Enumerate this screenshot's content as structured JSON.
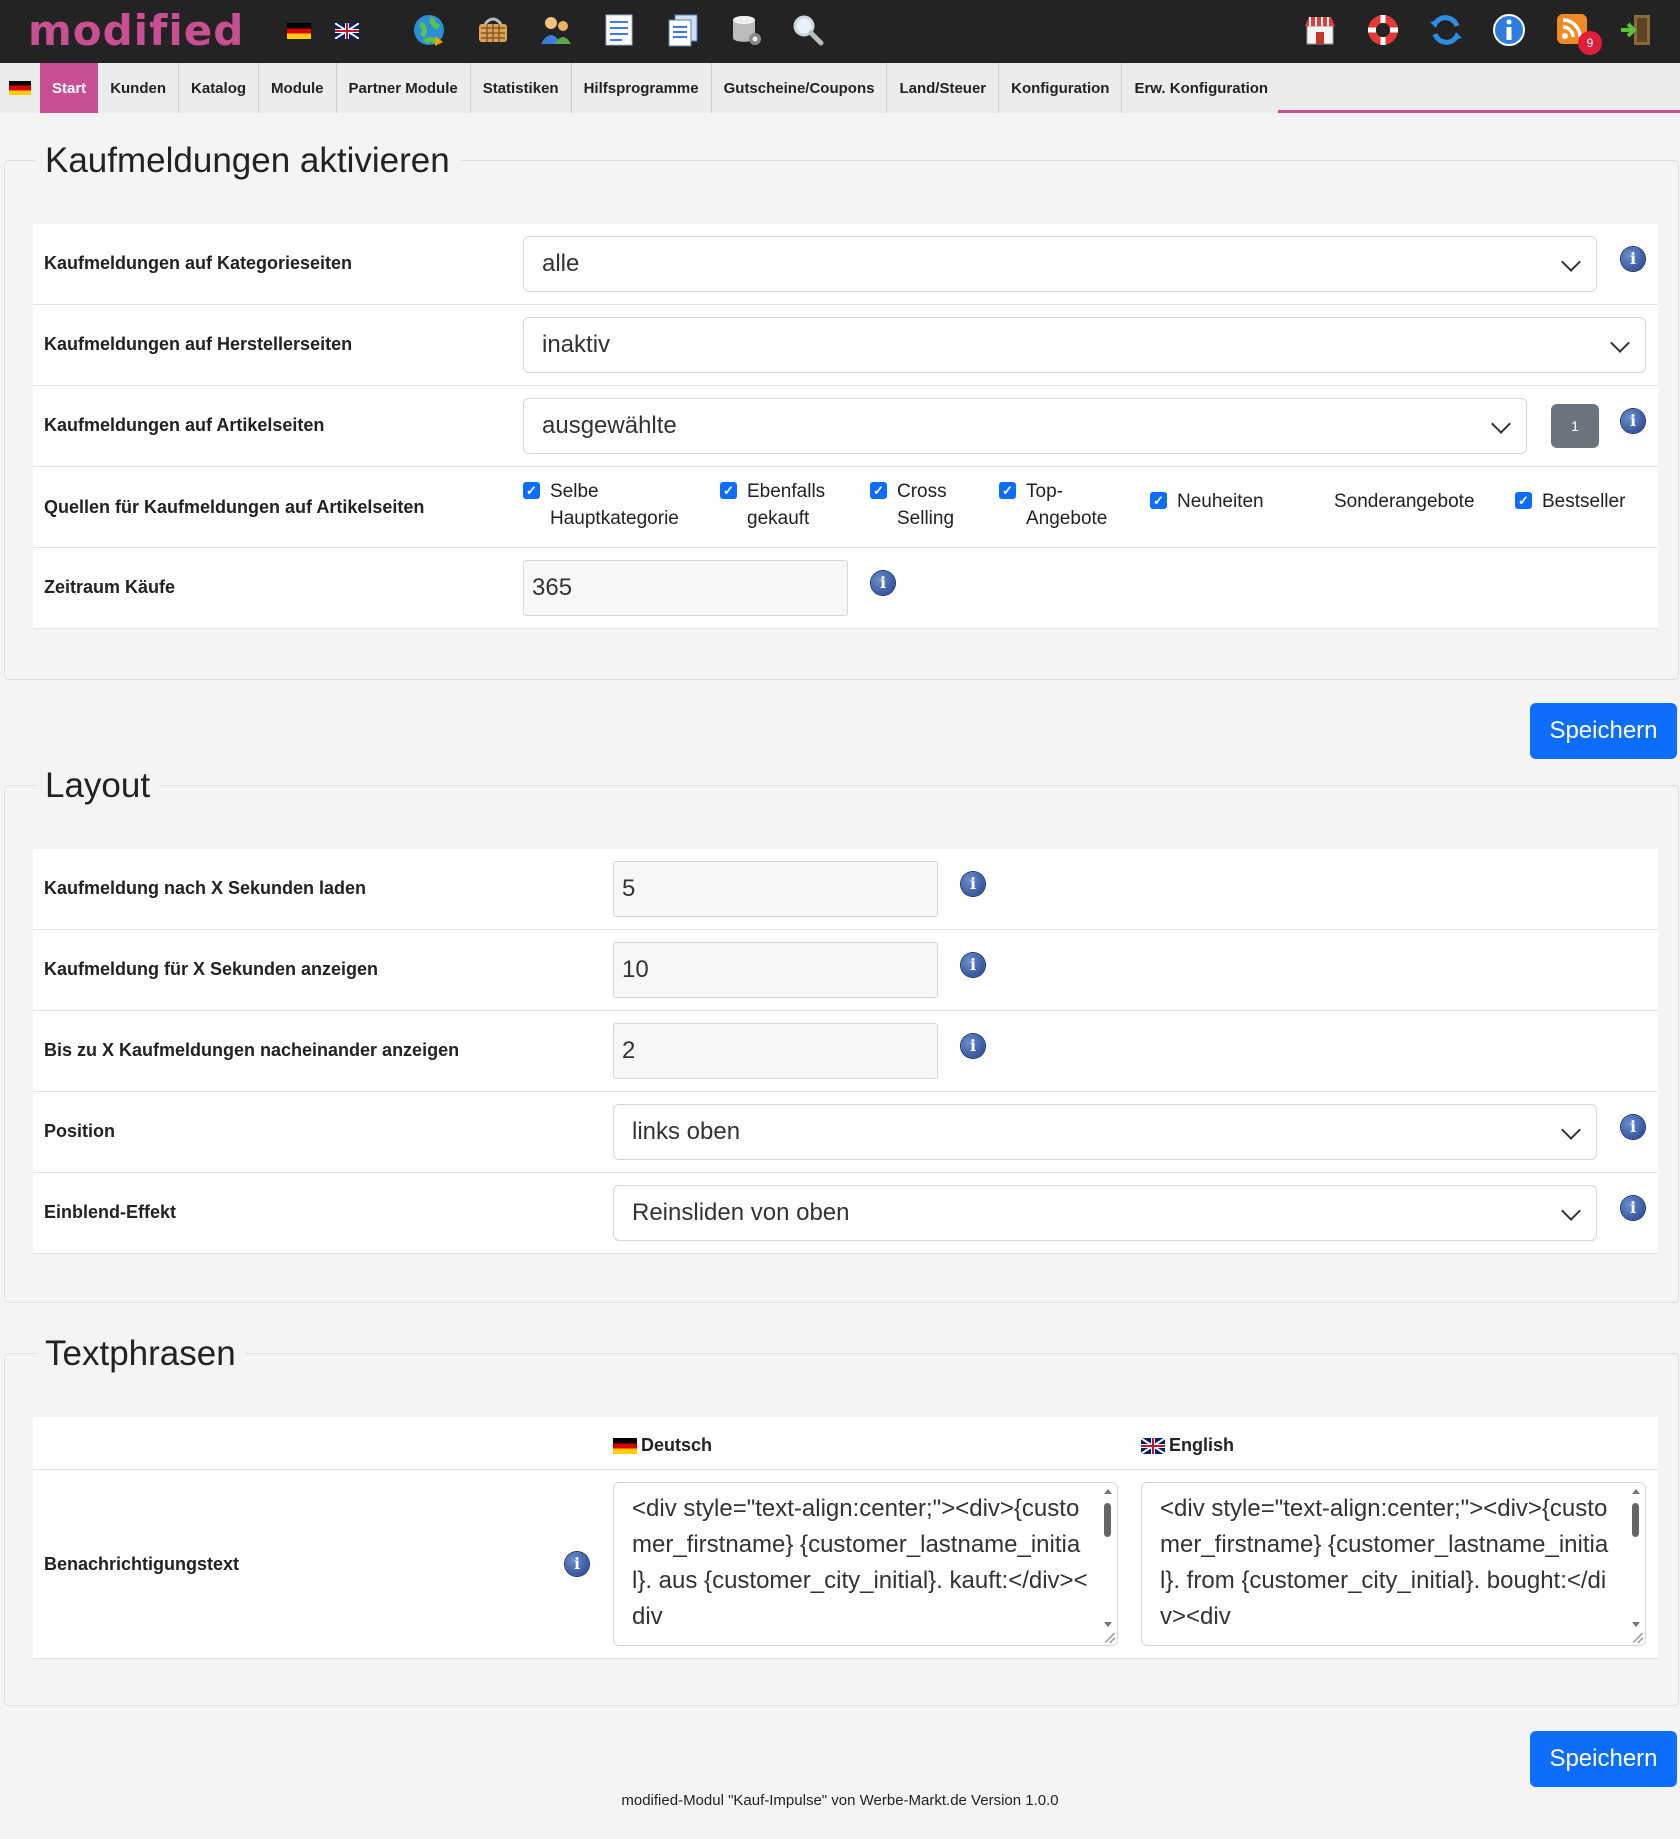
{
  "app": {
    "logo": "modified"
  },
  "topbar": {
    "flags": [
      "de-flag",
      "gb-flag"
    ],
    "left_icons": [
      "globe-icon",
      "basket-icon",
      "customers-icon",
      "orders-icon",
      "documents-icon",
      "database-icon",
      "search-icon"
    ],
    "right_icons": [
      "shop-icon",
      "support-icon",
      "refresh-icon",
      "info-icon",
      "rss-icon",
      "logout-icon"
    ],
    "notification_count": "9",
    "accent": "#c94f93"
  },
  "nav": {
    "items": [
      {
        "label": "Start",
        "active": true
      },
      {
        "label": "Kunden"
      },
      {
        "label": "Katalog"
      },
      {
        "label": "Module"
      },
      {
        "label": "Partner Module"
      },
      {
        "label": "Statistiken"
      },
      {
        "label": "Hilfsprogramme"
      },
      {
        "label": "Gutscheine/Coupons"
      },
      {
        "label": "Land/Steuer"
      },
      {
        "label": "Konfiguration"
      },
      {
        "label": "Erw. Konfiguration"
      }
    ]
  },
  "section1": {
    "title": "Kaufmeldungen aktivieren",
    "rows": {
      "category": {
        "label": "Kaufmeldungen auf Kategorieseiten",
        "value": "alle"
      },
      "manufacturer": {
        "label": "Kaufmeldungen auf Herstellerseiten",
        "value": "inaktiv"
      },
      "product": {
        "label": "Kaufmeldungen auf Artikelseiten",
        "value": "ausgewählte",
        "button": "1"
      },
      "sources": {
        "label": "Quellen für Kaufmeldungen auf Artikelseiten",
        "options": [
          {
            "label": "Selbe Hauptkategorie",
            "checked": true
          },
          {
            "label": "Ebenfalls gekauft",
            "checked": true
          },
          {
            "label": "Cross Selling",
            "checked": true
          },
          {
            "label": "Top-Angebote",
            "checked": true
          },
          {
            "label": "Neuheiten",
            "checked": true
          },
          {
            "label": "Sonderangebote",
            "checked": false
          },
          {
            "label": "Bestseller",
            "checked": true
          }
        ]
      },
      "period": {
        "label": "Zeitraum Käufe",
        "value": "365"
      }
    },
    "save": "Speichern"
  },
  "section2": {
    "title": "Layout",
    "rows": {
      "delay": {
        "label": "Kaufmeldung nach X Sekunden laden",
        "value": "5"
      },
      "duration": {
        "label": "Kaufmeldung für X Sekunden anzeigen",
        "value": "10"
      },
      "count": {
        "label": "Bis zu X Kaufmeldungen nacheinander anzeigen",
        "value": "2"
      },
      "position": {
        "label": "Position",
        "value": "links oben"
      },
      "effect": {
        "label": "Einblend-Effekt",
        "value": "Reinsliden von oben"
      }
    }
  },
  "section3": {
    "title": "Textphrasen",
    "col_de": "Deutsch",
    "col_en": "English",
    "row_label": "Benachrichtigungstext",
    "text_de": "<div style=\"text-align:center;\"><div>{customer_firstname} {customer_lastname_initial}. aus {customer_city_initial}. kauft:</div><div",
    "text_en": "<div style=\"text-align:center;\"><div>{customer_firstname} {customer_lastname_initial}. from {customer_city_initial}. bought:</div><div",
    "save": "Speichern"
  },
  "footer": "modified-Modul \"Kauf-Impulse\" von Werbe-Markt.de Version 1.0.0"
}
